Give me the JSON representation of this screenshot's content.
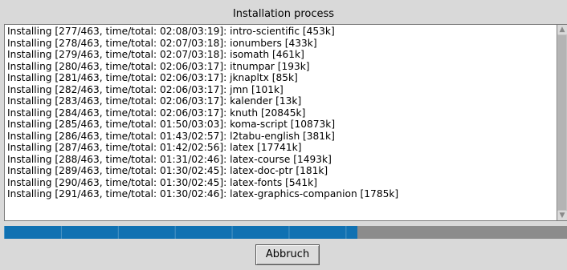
{
  "window": {
    "title": "Installation process"
  },
  "log": {
    "lines": [
      "Installing [277/463, time/total: 02:08/03:19]: intro-scientific [453k]",
      "Installing [278/463, time/total: 02:07/03:18]: ionumbers [433k]",
      "Installing [279/463, time/total: 02:07/03:18]: isomath [461k]",
      "Installing [280/463, time/total: 02:06/03:17]: itnumpar [193k]",
      "Installing [281/463, time/total: 02:06/03:17]: jknapltx [85k]",
      "Installing [282/463, time/total: 02:06/03:17]: jmn [101k]",
      "Installing [283/463, time/total: 02:06/03:17]: kalender [13k]",
      "Installing [284/463, time/total: 02:06/03:17]: knuth [20845k]",
      "Installing [285/463, time/total: 01:50/03:03]: koma-script [10873k]",
      "Installing [286/463, time/total: 01:43/02:57]: l2tabu-english [381k]",
      "Installing [287/463, time/total: 01:42/02:56]: latex [17741k]",
      "Installing [288/463, time/total: 01:31/02:46]: latex-course [1493k]",
      "Installing [289/463, time/total: 01:30/02:45]: latex-doc-ptr [181k]",
      "Installing [290/463, time/total: 01:30/02:45]: latex-fonts [541k]",
      "Installing [291/463, time/total: 01:30/02:46]: latex-graphics-companion [1785k]"
    ]
  },
  "scrollbar": {
    "up_icon": "triangle-up-icon",
    "down_icon": "triangle-down-icon"
  },
  "progress": {
    "fraction": 0.628,
    "fill_color": "#1071b2",
    "track_color": "#8c8c8c"
  },
  "buttons": {
    "cancel_label": "Abbruch"
  }
}
